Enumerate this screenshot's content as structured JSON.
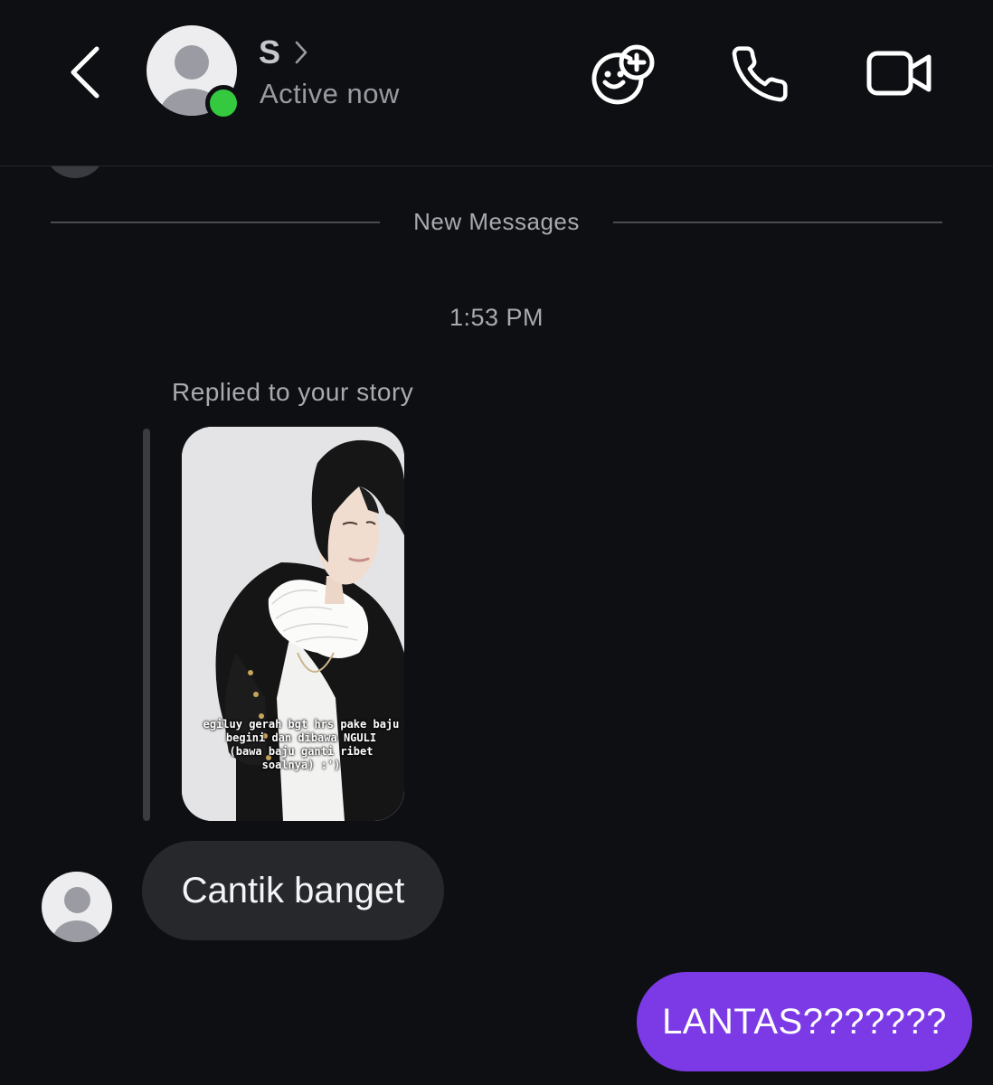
{
  "colors": {
    "background": "#0d0f13",
    "incoming_bubble": "#26282c",
    "outgoing_bubble": "#7c3ae6",
    "online_indicator": "#34c93f",
    "secondary_text": "#a9aab0"
  },
  "header": {
    "back_icon": "chevron-left-icon",
    "contact": {
      "name": "S",
      "status": "Active now",
      "name_chevron_icon": "chevron-right-icon",
      "online": true
    },
    "actions": [
      {
        "name": "add-effect-button",
        "icon": "face-plus-icon"
      },
      {
        "name": "voice-call-button",
        "icon": "phone-icon"
      },
      {
        "name": "video-call-button",
        "icon": "video-camera-icon"
      }
    ]
  },
  "chat": {
    "divider_label": "New Messages",
    "timestamp": "1:53 PM",
    "story_reply": {
      "caption": "Replied to your story",
      "story_text_lines": [
        "egiluy gerah bgt hrs pake baju",
        "begini dan dibawa NGULI",
        "(bawa baju ganti ribet",
        "soalnya) :')"
      ]
    },
    "messages": [
      {
        "direction": "incoming",
        "text": "Cantik banget"
      },
      {
        "direction": "outgoing",
        "text": "LANTAS???????"
      }
    ]
  }
}
